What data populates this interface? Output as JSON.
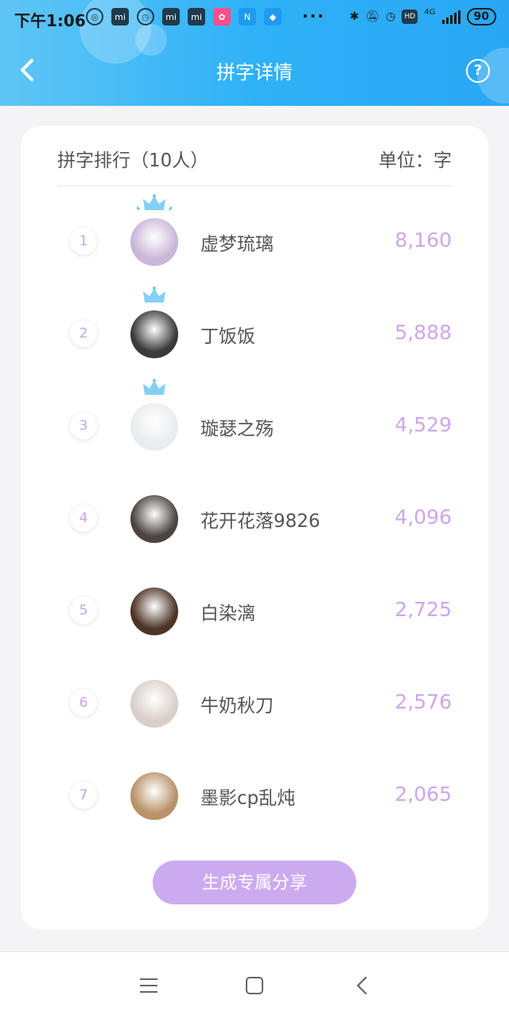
{
  "status_bar": {
    "time": "下午1:06",
    "dots": "···",
    "battery": "90",
    "network": "4G",
    "hd": "HD"
  },
  "header": {
    "title": "拼字详情",
    "back_icon": "chevron-left-icon",
    "help_icon": "question-circle-icon",
    "help_glyph": "?"
  },
  "card": {
    "ranking_title": "拼字排行（10人）",
    "unit_label": "单位：字"
  },
  "ranking": [
    {
      "rank": "1",
      "name": "虚梦琉璃",
      "score": "8,160",
      "crown": true,
      "avatar_color": "#c9b6d8"
    },
    {
      "rank": "2",
      "name": "丁饭饭",
      "score": "5,888",
      "crown": true,
      "avatar_color": "#3a3a3a"
    },
    {
      "rank": "3",
      "name": "璇瑟之殇",
      "score": "4,529",
      "crown": true,
      "avatar_color": "#e9ecef"
    },
    {
      "rank": "4",
      "name": "花开花落9826",
      "score": "4,096",
      "crown": false,
      "avatar_color": "#4b4440"
    },
    {
      "rank": "5",
      "name": "白染漓",
      "score": "2,725",
      "crown": false,
      "avatar_color": "#4d3426"
    },
    {
      "rank": "6",
      "name": "牛奶秋刀",
      "score": "2,576",
      "crown": false,
      "avatar_color": "#d9cfc8"
    },
    {
      "rank": "7",
      "name": "墨影cp乱炖",
      "score": "2,065",
      "crown": false,
      "avatar_color": "#b89268"
    }
  ],
  "share_button": {
    "label": "生成专属分享"
  },
  "colors": {
    "header_gradient_start": "#5fc6f6",
    "header_gradient_end": "#2aa7f4",
    "score_color": "#cfa6ea",
    "share_button": "#ccaaf0"
  },
  "nav": {
    "menu_icon": "menu-icon",
    "home_icon": "square-home-icon",
    "back_icon": "back-triangle-icon"
  }
}
